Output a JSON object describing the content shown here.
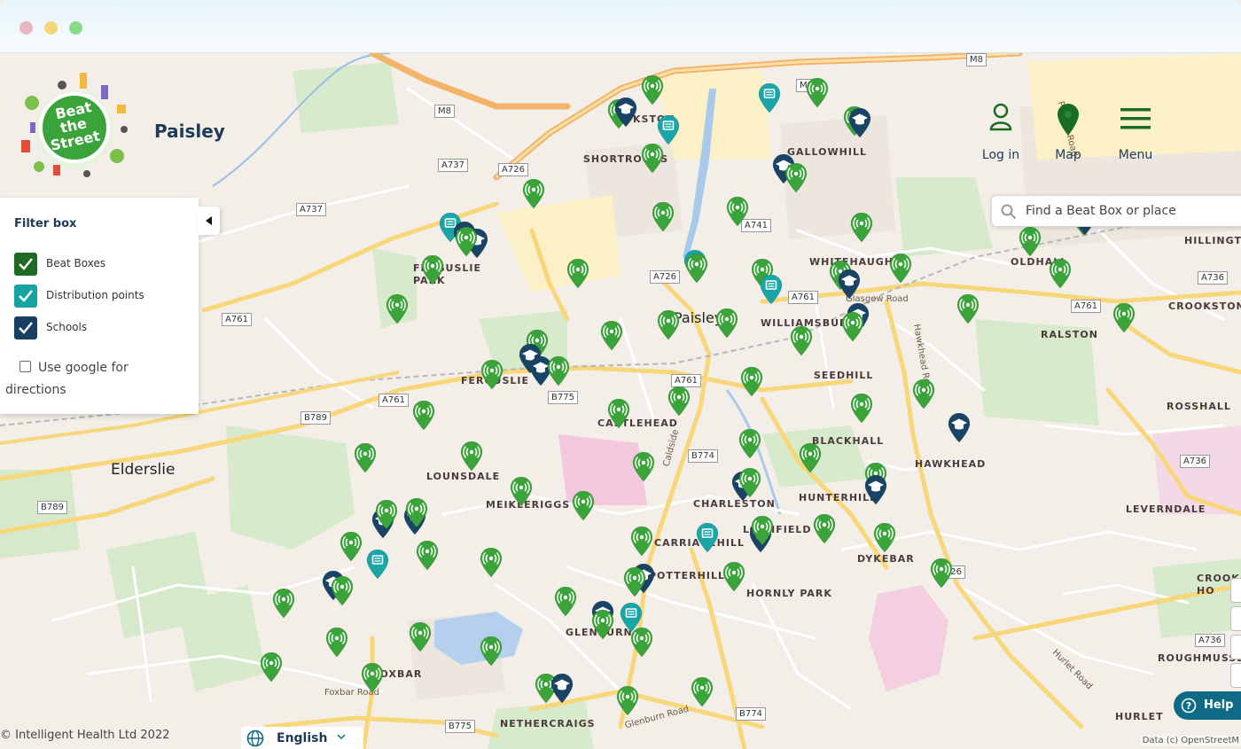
{
  "app": {
    "city": "Paisley",
    "logo_text": [
      "Beat",
      "the",
      "Street"
    ]
  },
  "nav": {
    "login": "Log in",
    "map": "Map",
    "menu": "Menu"
  },
  "search": {
    "placeholder": "Find a Beat Box or place"
  },
  "filter": {
    "title": "Filter box",
    "items": [
      {
        "label": "Beat Boxes",
        "checked": true,
        "color": "#1f6b24"
      },
      {
        "label": "Distribution points",
        "checked": true,
        "color": "#17a3a3"
      },
      {
        "label": "Schools",
        "checked": true,
        "color": "#173f63"
      }
    ],
    "google_label": "Use google for directions",
    "google_checked": false
  },
  "footer": {
    "copyright": "© Intelligent Health Ltd 2022",
    "language": "English",
    "attribution": "Data (c) OpenStreetM"
  },
  "help": {
    "label": "Help"
  },
  "map_labels": {
    "places": [
      "PAISLEY",
      "ELDERSLIE"
    ],
    "areas": [
      "KSTON",
      "SHORTROODS",
      "GALLOWHILL",
      "FERGUSLIE PARK",
      "WHITEHAUGH",
      "OLDHALL",
      "HILLINGTO",
      "WILLIAMSBURGH",
      "RALSTON",
      "CROOKSTON",
      "SEEDHILL",
      "FERGUSLIE",
      "CASTLEHEAD",
      "ROSSHALL",
      "BLACKHALL",
      "HAWKHEAD",
      "LOUNSDALE",
      "MEIKLERIGGS",
      "CHARLESTON",
      "HUNTERHILL",
      "LEVERNDALE",
      "LOCHFIELD",
      "CARRIAGEHILL",
      "DYKEBAR",
      "POTTERHILL",
      "HORNLY PARK",
      "GLENBURN",
      "FOXBAR",
      "NETHERCRAIGS",
      "HURLET",
      "ROUGHMUSSE",
      "CROOK HO"
    ],
    "roads": [
      "M8",
      "A737",
      "A726",
      "A761",
      "B789",
      "B775",
      "B774",
      "A736",
      "Glasgow Road",
      "Hawkhead Road",
      "Hurlet Road",
      "Caldside",
      "Glenburn Road",
      "Foxbar Road",
      "Penilee Road",
      "A741"
    ]
  },
  "colors": {
    "beatbox": "#3aa43a",
    "distribution": "#1aa6a8",
    "school": "#1a4466",
    "brand_dark": "#1d3a57"
  }
}
